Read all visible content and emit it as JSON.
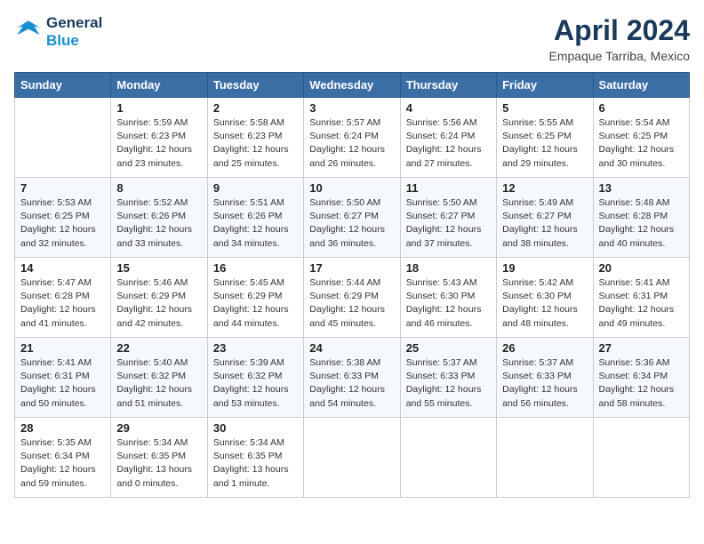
{
  "logo": {
    "line1": "General",
    "line2": "Blue"
  },
  "title": "April 2024",
  "subtitle": "Empaque Tarriba, Mexico",
  "days_header": [
    "Sunday",
    "Monday",
    "Tuesday",
    "Wednesday",
    "Thursday",
    "Friday",
    "Saturday"
  ],
  "weeks": [
    [
      {
        "day": "",
        "info": ""
      },
      {
        "day": "1",
        "info": "Sunrise: 5:59 AM\nSunset: 6:23 PM\nDaylight: 12 hours\nand 23 minutes."
      },
      {
        "day": "2",
        "info": "Sunrise: 5:58 AM\nSunset: 6:23 PM\nDaylight: 12 hours\nand 25 minutes."
      },
      {
        "day": "3",
        "info": "Sunrise: 5:57 AM\nSunset: 6:24 PM\nDaylight: 12 hours\nand 26 minutes."
      },
      {
        "day": "4",
        "info": "Sunrise: 5:56 AM\nSunset: 6:24 PM\nDaylight: 12 hours\nand 27 minutes."
      },
      {
        "day": "5",
        "info": "Sunrise: 5:55 AM\nSunset: 6:25 PM\nDaylight: 12 hours\nand 29 minutes."
      },
      {
        "day": "6",
        "info": "Sunrise: 5:54 AM\nSunset: 6:25 PM\nDaylight: 12 hours\nand 30 minutes."
      }
    ],
    [
      {
        "day": "7",
        "info": "Sunrise: 5:53 AM\nSunset: 6:25 PM\nDaylight: 12 hours\nand 32 minutes."
      },
      {
        "day": "8",
        "info": "Sunrise: 5:52 AM\nSunset: 6:26 PM\nDaylight: 12 hours\nand 33 minutes."
      },
      {
        "day": "9",
        "info": "Sunrise: 5:51 AM\nSunset: 6:26 PM\nDaylight: 12 hours\nand 34 minutes."
      },
      {
        "day": "10",
        "info": "Sunrise: 5:50 AM\nSunset: 6:27 PM\nDaylight: 12 hours\nand 36 minutes."
      },
      {
        "day": "11",
        "info": "Sunrise: 5:50 AM\nSunset: 6:27 PM\nDaylight: 12 hours\nand 37 minutes."
      },
      {
        "day": "12",
        "info": "Sunrise: 5:49 AM\nSunset: 6:27 PM\nDaylight: 12 hours\nand 38 minutes."
      },
      {
        "day": "13",
        "info": "Sunrise: 5:48 AM\nSunset: 6:28 PM\nDaylight: 12 hours\nand 40 minutes."
      }
    ],
    [
      {
        "day": "14",
        "info": "Sunrise: 5:47 AM\nSunset: 6:28 PM\nDaylight: 12 hours\nand 41 minutes."
      },
      {
        "day": "15",
        "info": "Sunrise: 5:46 AM\nSunset: 6:29 PM\nDaylight: 12 hours\nand 42 minutes."
      },
      {
        "day": "16",
        "info": "Sunrise: 5:45 AM\nSunset: 6:29 PM\nDaylight: 12 hours\nand 44 minutes."
      },
      {
        "day": "17",
        "info": "Sunrise: 5:44 AM\nSunset: 6:29 PM\nDaylight: 12 hours\nand 45 minutes."
      },
      {
        "day": "18",
        "info": "Sunrise: 5:43 AM\nSunset: 6:30 PM\nDaylight: 12 hours\nand 46 minutes."
      },
      {
        "day": "19",
        "info": "Sunrise: 5:42 AM\nSunset: 6:30 PM\nDaylight: 12 hours\nand 48 minutes."
      },
      {
        "day": "20",
        "info": "Sunrise: 5:41 AM\nSunset: 6:31 PM\nDaylight: 12 hours\nand 49 minutes."
      }
    ],
    [
      {
        "day": "21",
        "info": "Sunrise: 5:41 AM\nSunset: 6:31 PM\nDaylight: 12 hours\nand 50 minutes."
      },
      {
        "day": "22",
        "info": "Sunrise: 5:40 AM\nSunset: 6:32 PM\nDaylight: 12 hours\nand 51 minutes."
      },
      {
        "day": "23",
        "info": "Sunrise: 5:39 AM\nSunset: 6:32 PM\nDaylight: 12 hours\nand 53 minutes."
      },
      {
        "day": "24",
        "info": "Sunrise: 5:38 AM\nSunset: 6:33 PM\nDaylight: 12 hours\nand 54 minutes."
      },
      {
        "day": "25",
        "info": "Sunrise: 5:37 AM\nSunset: 6:33 PM\nDaylight: 12 hours\nand 55 minutes."
      },
      {
        "day": "26",
        "info": "Sunrise: 5:37 AM\nSunset: 6:33 PM\nDaylight: 12 hours\nand 56 minutes."
      },
      {
        "day": "27",
        "info": "Sunrise: 5:36 AM\nSunset: 6:34 PM\nDaylight: 12 hours\nand 58 minutes."
      }
    ],
    [
      {
        "day": "28",
        "info": "Sunrise: 5:35 AM\nSunset: 6:34 PM\nDaylight: 12 hours\nand 59 minutes."
      },
      {
        "day": "29",
        "info": "Sunrise: 5:34 AM\nSunset: 6:35 PM\nDaylight: 13 hours\nand 0 minutes."
      },
      {
        "day": "30",
        "info": "Sunrise: 5:34 AM\nSunset: 6:35 PM\nDaylight: 13 hours\nand 1 minute."
      },
      {
        "day": "",
        "info": ""
      },
      {
        "day": "",
        "info": ""
      },
      {
        "day": "",
        "info": ""
      },
      {
        "day": "",
        "info": ""
      }
    ]
  ]
}
